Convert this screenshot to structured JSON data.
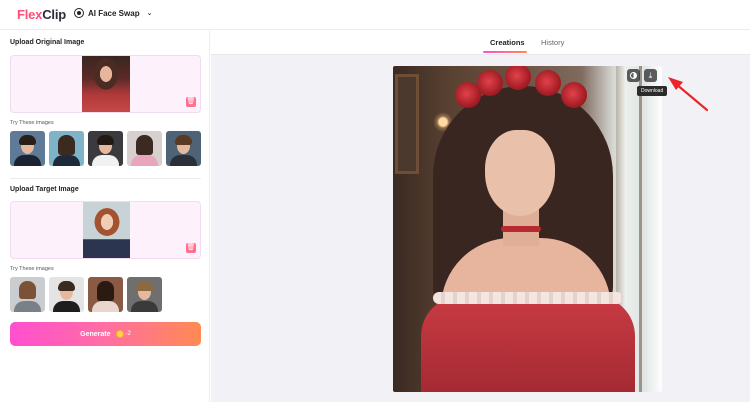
{
  "header": {
    "logo_flex": "Flex",
    "logo_clip": "Clip",
    "tool_name": "AI Face Swap"
  },
  "left_panel": {
    "original_title": "Upload Original Image",
    "target_title": "Upload Target Image",
    "try_label": "Try These images",
    "generate_label": "Generate",
    "credit_cost": "-2"
  },
  "tabs": [
    {
      "label": "Creations",
      "active": true
    },
    {
      "label": "History",
      "active": false
    }
  ],
  "result": {
    "tooltip": "Download"
  },
  "colors": {
    "accent_pink": "#ff4fd0",
    "accent_orange": "#ff8a52",
    "upload_bg": "#fdf2fb",
    "arrow_red": "#e8262a"
  }
}
